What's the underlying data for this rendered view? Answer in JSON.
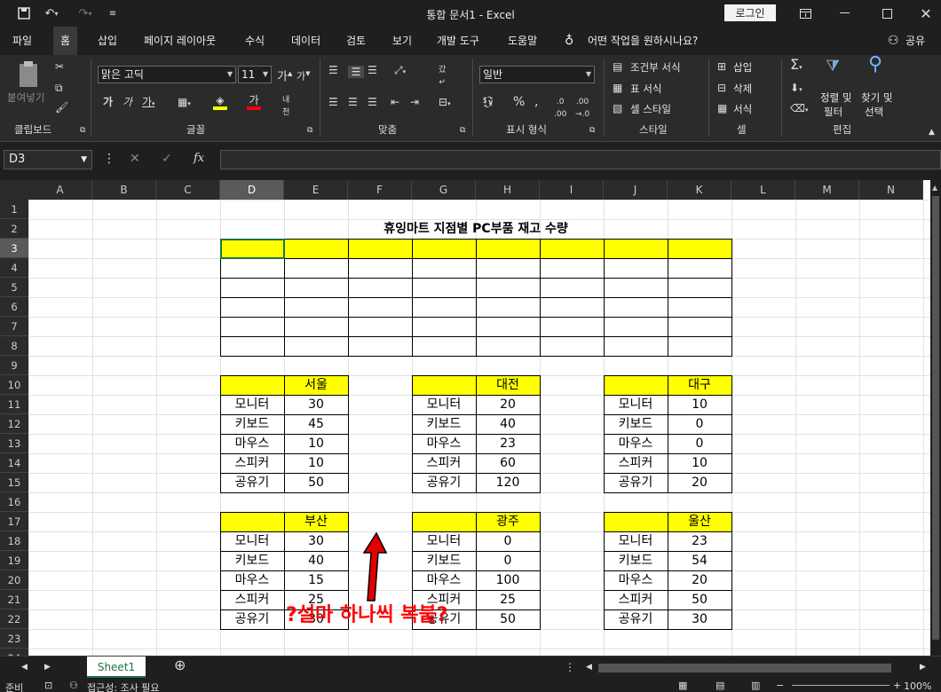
{
  "app": {
    "title": "통합 문서1 - Excel",
    "login": "로그인",
    "share": "공유"
  },
  "menu": [
    "파일",
    "홈",
    "삽입",
    "페이지 레이아웃",
    "수식",
    "데이터",
    "검토",
    "보기",
    "개발 도구",
    "도움말"
  ],
  "tellme": "어떤 작업을 원하시나요?",
  "ribbon": {
    "clipboard": {
      "label": "클립보드",
      "paste": "붙여넣기"
    },
    "font": {
      "label": "글꼴",
      "name": "맑은 고딕",
      "size": "11"
    },
    "align": {
      "label": "맞춤"
    },
    "number": {
      "label": "표시 형식",
      "format": "일반"
    },
    "styles": {
      "label": "스타일",
      "cond": "조건부 서식",
      "table": "표 서식",
      "cell": "셀 스타일"
    },
    "cells": {
      "label": "셀",
      "insert": "삽입",
      "delete": "삭제",
      "format": "서식"
    },
    "edit": {
      "label": "편집",
      "sort": "정렬 및",
      "sort2": "필터",
      "find": "찾기 및",
      "find2": "선택"
    }
  },
  "formula": {
    "namebox": "D3",
    "fx": "fx"
  },
  "columns": [
    "A",
    "B",
    "C",
    "D",
    "E",
    "F",
    "G",
    "H",
    "I",
    "J",
    "K",
    "L",
    "M",
    "N"
  ],
  "selected_col": "D",
  "selected_row": 3,
  "sheet": {
    "title": "휴잉마트 지점별 PC부품 재고 수량",
    "items": [
      "모니터",
      "키보드",
      "마우스",
      "스피커",
      "공유기"
    ],
    "stores": [
      {
        "name": "서울",
        "values": [
          "30",
          "45",
          "10",
          "10",
          "50"
        ]
      },
      {
        "name": "대전",
        "values": [
          "20",
          "40",
          "23",
          "60",
          "120"
        ]
      },
      {
        "name": "대구",
        "values": [
          "10",
          "0",
          "0",
          "10",
          "20"
        ]
      },
      {
        "name": "부산",
        "values": [
          "30",
          "40",
          "15",
          "25",
          "30"
        ]
      },
      {
        "name": "광주",
        "values": [
          "0",
          "0",
          "100",
          "25",
          "50"
        ]
      },
      {
        "name": "울산",
        "values": [
          "23",
          "54",
          "20",
          "50",
          "30"
        ]
      }
    ]
  },
  "annotation": "?설마 하나씩 복붙?",
  "tabs": {
    "sheet": "Sheet1"
  },
  "status": {
    "ready": "준비",
    "accessibility": "접근성: 조사 필요",
    "zoom": "100%"
  }
}
